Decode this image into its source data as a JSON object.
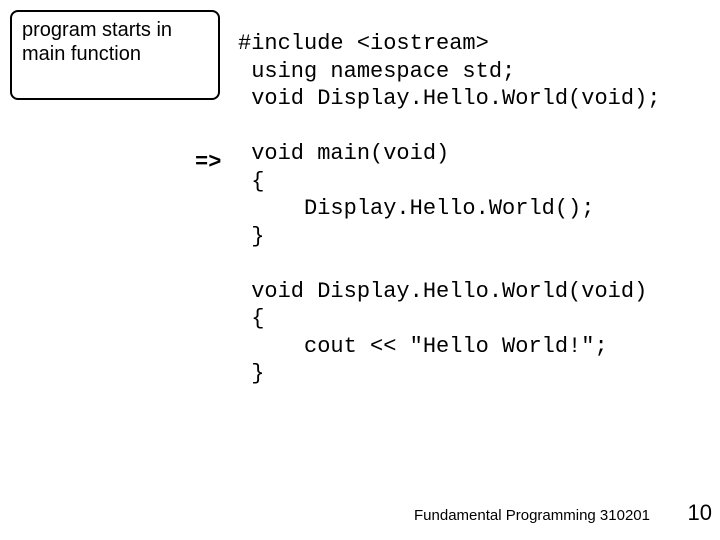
{
  "callout": {
    "text": "program starts in main function"
  },
  "arrow": {
    "symbol": "=>"
  },
  "code": {
    "text": "#include <iostream>\n using namespace std;\n void Display.Hello.World(void);\n\n void main(void)\n {\n     Display.Hello.World();\n }\n\n void Display.Hello.World(void)\n {\n     cout << \"Hello World!\";\n }"
  },
  "footer": {
    "text": "Fundamental Programming 310201"
  },
  "page": {
    "number": "10"
  }
}
